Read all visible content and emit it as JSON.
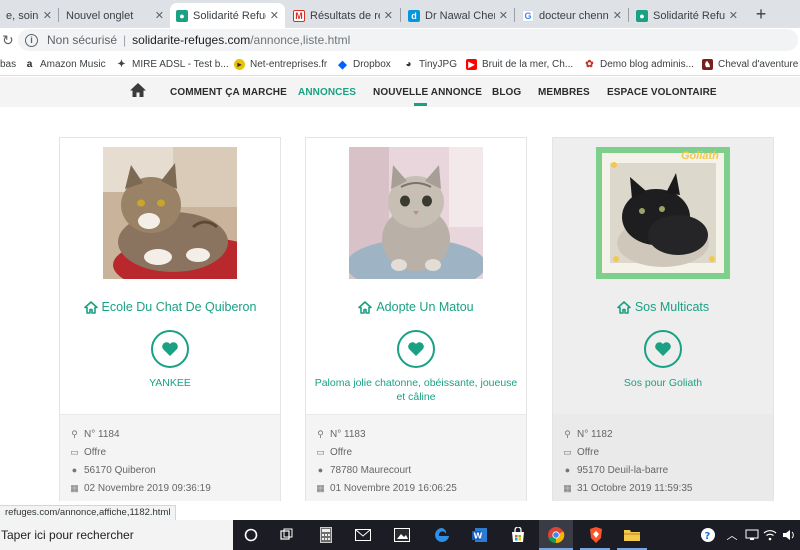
{
  "browser": {
    "tabs": [
      {
        "label": "e, soins",
        "icon": "tab-partial-icon",
        "color": "#9aa0a6"
      },
      {
        "label": "Nouvel onglet",
        "icon": "new-tab-page-icon",
        "color": "#9aa0a6"
      },
      {
        "label": "Solidarité Refug",
        "icon": "solidarite-refuges-favicon",
        "color": "#1aa184",
        "active": true
      },
      {
        "label": "Résultats de rec",
        "icon": "gmail-icon",
        "color": "#d93025"
      },
      {
        "label": "Dr Nawal Chenni",
        "icon": "doctolib-icon",
        "color": "#0596de"
      },
      {
        "label": "docteur chenni",
        "icon": "google-icon",
        "color": "#4285f4"
      },
      {
        "label": "Solidarité Refug",
        "icon": "solidarite-refuges-favicon",
        "color": "#1aa184"
      }
    ],
    "new_tab_symbol": "+",
    "close_symbol": "✕",
    "address": {
      "security_label": "Non sécurisé",
      "host": "solidarite-refuges.com",
      "path": "/annonce,liste.html"
    },
    "bookmarks": [
      {
        "label": "bas",
        "icon": "blank-icon",
        "color": "#9aa0a6"
      },
      {
        "label": "Amazon Music",
        "icon": "amazon-icon",
        "color": "#222222"
      },
      {
        "label": "MIRE ADSL - Test b...",
        "icon": "mire-icon",
        "color": "#444444"
      },
      {
        "label": "Net-entreprises.fr",
        "icon": "net-entreprises-icon",
        "color": "#e7c20a"
      },
      {
        "label": "Dropbox",
        "icon": "dropbox-icon",
        "color": "#0061fe"
      },
      {
        "label": "TinyJPG",
        "icon": "tinyjpg-panda-icon",
        "color": "#444444"
      },
      {
        "label": "Bruit de la mer, Ch...",
        "icon": "youtube-icon",
        "color": "#ff0000"
      },
      {
        "label": "Demo blog adminis...",
        "icon": "blog-icon",
        "color": "#c0392b"
      },
      {
        "label": "Cheval d'aventure s...",
        "icon": "cheval-icon",
        "color": "#7b1e1e"
      }
    ]
  },
  "site_nav": {
    "items": [
      {
        "label": "COMMENT ÇA MARCHE",
        "active": false
      },
      {
        "label": "ANNONCES",
        "active": true
      },
      {
        "label": "NOUVELLE ANNONCE",
        "active": false
      },
      {
        "label": "BLOG",
        "active": false
      },
      {
        "label": "MEMBRES",
        "active": false
      },
      {
        "label": "ESPACE VOLONTAIRE",
        "active": false
      }
    ],
    "accent": "#1aa184"
  },
  "cards": [
    {
      "association": "Ecole Du Chat De Quiberon",
      "animal": "YANKEE",
      "numero": "N° 1184",
      "type": "Offre",
      "location": "56170 Quiberon",
      "date": "02 Novembre 2019 09:36:19",
      "photo": "tabby-cat-on-red-blanket"
    },
    {
      "association": "Adopte Un Matou",
      "animal": "Paloma jolie chatonne, obéissante, joueuse et câline",
      "numero": "N° 1183",
      "type": "Offre",
      "location": "78780 Maurecourt",
      "date": "01 Novembre 2019 16:06:25",
      "photo": "silver-tabby-kitten-on-bed"
    },
    {
      "association": "Sos Multicats",
      "animal": "Sos pour Goliath",
      "numero": "N° 1182",
      "type": "Offre",
      "location": "95170 Deuil-la-barre",
      "date": "31 Octobre 2019 11:59:35",
      "photo": "black-cat-framed",
      "photo_caption": "Goliath"
    }
  ],
  "status_bar_url": "refuges.com/annonce,affiche,1182.html",
  "taskbar": {
    "search_placeholder": "Taper ici pour rechercher",
    "apps": [
      "cortana-icon",
      "task-view-icon",
      "calculator-icon",
      "mail-icon",
      "photos-icon",
      "edge-icon",
      "word-icon",
      "store-icon",
      "chrome-icon",
      "brave-icon",
      "file-explorer-icon"
    ],
    "tray": [
      "help-icon",
      "chevron-up-icon",
      "network-icon",
      "wifi-icon",
      "volume-icon"
    ]
  }
}
